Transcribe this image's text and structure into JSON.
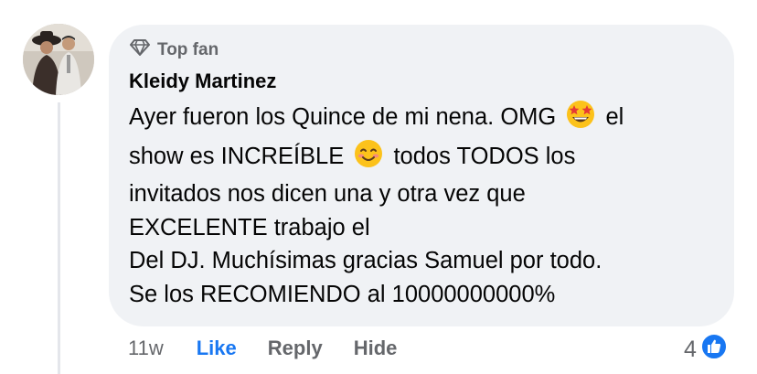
{
  "comment": {
    "badge": "Top fan",
    "author": "Kleidy Martinez",
    "lines": {
      "l1a": "Ayer fueron los Quince de mi nena. OMG",
      "l1b": "el",
      "l2a": "show es INCREÍBLE",
      "l2b": "todos TODOS los",
      "l3": "invitados nos dicen una y otra vez que",
      "l4": "EXCELENTE trabajo el",
      "l5": "Del DJ.  Muchísimas gracias Samuel por todo.",
      "l6": "Se los RECOMIENDO al 10000000000%"
    },
    "emojis": [
      "star-struck-emoji",
      "smiling-face-emoji"
    ]
  },
  "actions": {
    "time": "11w",
    "like": "Like",
    "reply": "Reply",
    "hide": "Hide"
  },
  "reactions": {
    "count": "4",
    "icon": "like-reaction-icon"
  },
  "colors": {
    "bubble": "#f0f2f5",
    "like_blue": "#1877f2",
    "secondary_text": "#65676b"
  }
}
